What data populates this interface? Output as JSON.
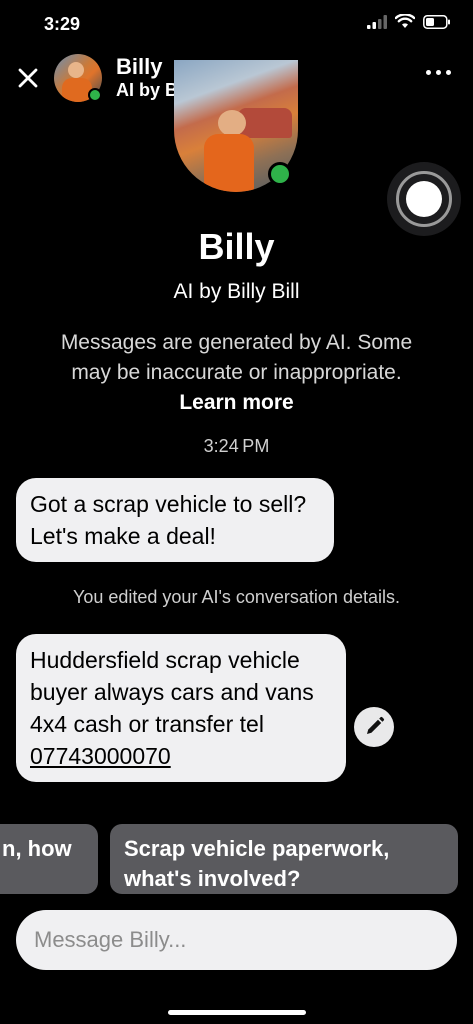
{
  "status": {
    "time": "3:29"
  },
  "header": {
    "name": "Billy",
    "subtitle": "AI by Billy Bill"
  },
  "profile": {
    "name": "Billy",
    "subtitle": "AI by Billy Bill",
    "disclaimer_text": "Messages are generated by AI. Some may be inaccurate or inappropriate.",
    "learn_more": "Learn more"
  },
  "chat": {
    "timestamp": "3:24 PM",
    "ai_message": "Got a scrap vehicle to sell? Let's make a deal!",
    "edit_note": "You edited your AI's conversation details.",
    "user_message": "Huddersfield scrap vehicle buyer always cars and vans 4x4 cash or transfer tel",
    "phone": "07743000070"
  },
  "suggestions": [
    {
      "label": "n, how"
    },
    {
      "label": "Scrap vehicle paperwork, what's involved?"
    }
  ],
  "composer": {
    "placeholder": "Message Billy..."
  },
  "colors": {
    "background": "#000000",
    "bubble": "#f0f0f2",
    "online": "#2fb34a",
    "suggestion": "#5a5a5e"
  }
}
